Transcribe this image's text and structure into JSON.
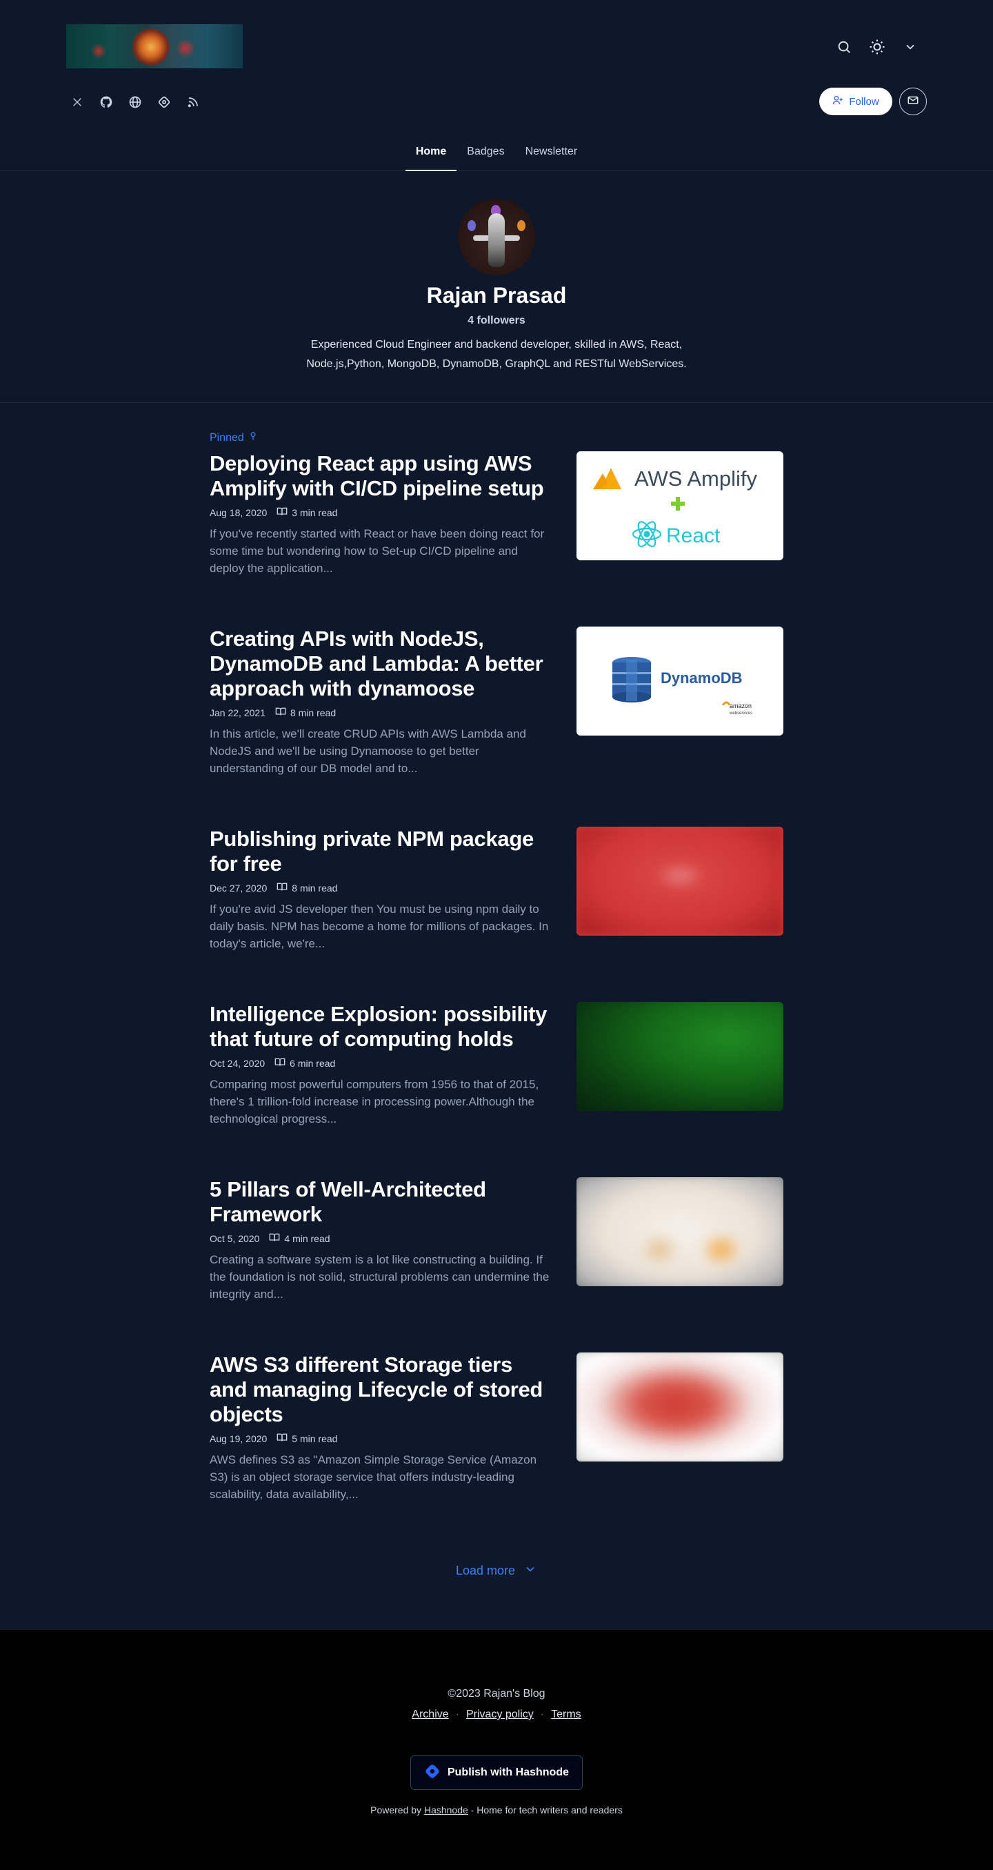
{
  "header": {
    "logo_alt": "blog-logo",
    "icons": [
      "search-icon",
      "sun-icon",
      "chevron-down-icon"
    ],
    "socials": [
      "x-icon",
      "github-icon",
      "globe-icon",
      "hashnode-icon",
      "rss-icon"
    ],
    "follow_label": "Follow",
    "tabs": [
      "Home",
      "Badges",
      "Newsletter"
    ]
  },
  "profile": {
    "name": "Rajan Prasad",
    "followers": "4 followers",
    "bio": "Experienced Cloud Engineer and backend developer, skilled in AWS, React, Node.js,Python, MongoDB, DynamoDB, GraphQL and RESTful WebServices."
  },
  "pinned_label": "Pinned",
  "posts": [
    {
      "title": "Deploying React app using AWS Amplify with CI/CD pipeline setup",
      "date": "Aug 18, 2020",
      "read": "3 min read",
      "desc": "If you've recently started with React or have been doing react for some time but wondering how to Set-up CI/CD pipeline and deploy the application...",
      "thumb": {
        "line1": "AWS Amplify",
        "line2": "React"
      }
    },
    {
      "title": "Creating APIs with NodeJS, DynamoDB and Lambda: A better approach with dynamoose",
      "date": "Jan 22, 2021",
      "read": "8 min read",
      "desc": "In this article, we'll create CRUD APIs with AWS Lambda and NodeJS and we'll be using Dynamoose to get better understanding of our DB model and to...",
      "thumb": {
        "line1": "DynamoDB",
        "line2": "amazon",
        "line3": "webservices"
      }
    },
    {
      "title": "Publishing private NPM package for free",
      "date": "Dec 27, 2020",
      "read": "8 min read",
      "desc": "If you're avid JS developer then You must be using npm daily to daily basis. NPM has become a home for millions of packages. In today's article, we're..."
    },
    {
      "title": "Intelligence Explosion: possibility that future of computing holds",
      "date": "Oct 24, 2020",
      "read": "6 min read",
      "desc": "Comparing most powerful computers from 1956 to that of 2015, there's 1 trillion-fold increase in processing power.Although the technological progress..."
    },
    {
      "title": "5 Pillars of Well-Architected Framework",
      "date": "Oct 5, 2020",
      "read": "4 min read",
      "desc": "Creating a software system is a lot like constructing a building. If the foundation is not solid, structural problems can undermine the integrity and..."
    },
    {
      "title": "AWS S3 different Storage tiers and managing Lifecycle of stored objects",
      "date": "Aug 19, 2020",
      "read": "5 min read",
      "desc": "AWS defines S3 as \"Amazon Simple Storage Service (Amazon S3) is an object storage service that offers industry-leading scalability, data availability,..."
    }
  ],
  "load_more": "Load more",
  "footer": {
    "copyright": "©2023 Rajan's Blog",
    "links": [
      "Archive",
      "Privacy policy",
      "Terms"
    ],
    "publish": "Publish with Hashnode",
    "powered_prefix": "Powered by",
    "powered_link": "Hashnode",
    "powered_suffix": "- Home for tech writers and readers"
  },
  "colors": {
    "bg": "#0f172a",
    "accent": "#3b82f6",
    "footer_bg": "#000000"
  }
}
